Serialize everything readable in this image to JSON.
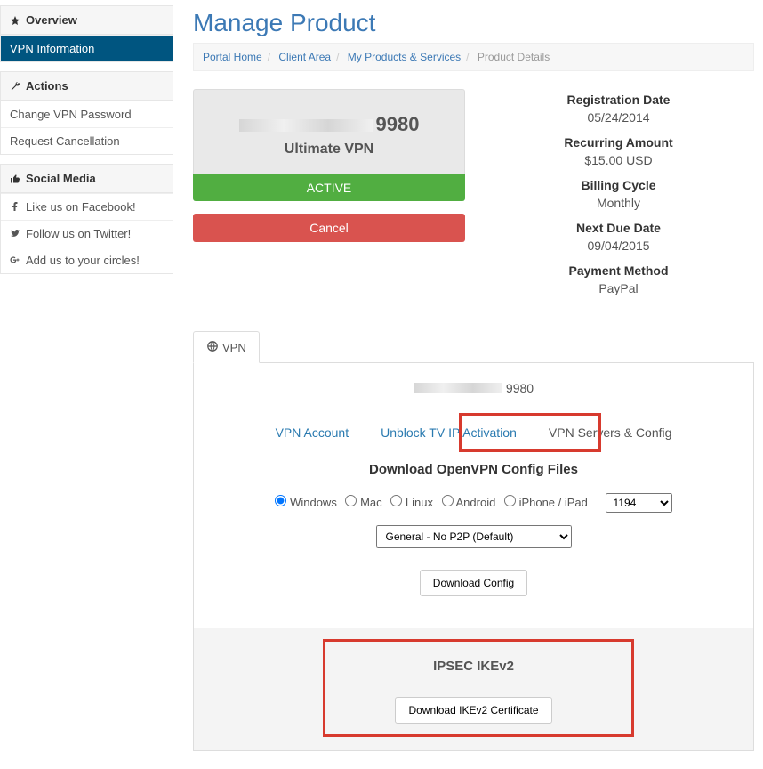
{
  "sidebar": {
    "overview": {
      "title": "Overview",
      "items": [
        {
          "label": "VPN Information"
        }
      ]
    },
    "actions": {
      "title": "Actions",
      "items": [
        {
          "label": "Change VPN Password"
        },
        {
          "label": "Request Cancellation"
        }
      ]
    },
    "social": {
      "title": "Social Media",
      "items": [
        {
          "label": "Like us on Facebook!"
        },
        {
          "label": "Follow us on Twitter!"
        },
        {
          "label": "Add us to your circles!"
        }
      ]
    }
  },
  "page": {
    "title": "Manage Product"
  },
  "breadcrumbs": {
    "a": "Portal Home",
    "b": "Client Area",
    "c": "My Products & Services",
    "d": "Product Details"
  },
  "product": {
    "id_suffix": "9980",
    "plan": "Ultimate VPN",
    "status": "ACTIVE",
    "cancel": "Cancel"
  },
  "details": {
    "reg_lbl": "Registration Date",
    "reg_val": "05/24/2014",
    "rec_lbl": "Recurring Amount",
    "rec_val": "$15.00 USD",
    "cyc_lbl": "Billing Cycle",
    "cyc_val": "Monthly",
    "due_lbl": "Next Due Date",
    "due_val": "09/04/2015",
    "pay_lbl": "Payment Method",
    "pay_val": "PayPal"
  },
  "tabs": {
    "vpn": "VPN"
  },
  "account_suffix": "9980",
  "subtabs": {
    "a": "VPN Account",
    "b": "Unblock TV IP Activation",
    "c": "VPN Servers & Config"
  },
  "openvpn": {
    "title": "Download OpenVPN Config Files",
    "os": {
      "win": "Windows",
      "mac": "Mac",
      "lin": "Linux",
      "and": "Android",
      "ios": "iPhone / iPad"
    },
    "port": "1194",
    "profile": "General - No P2P (Default)",
    "button": "Download Config"
  },
  "ipsec": {
    "title": "IPSEC IKEv2",
    "button": "Download IKEv2 Certificate"
  }
}
